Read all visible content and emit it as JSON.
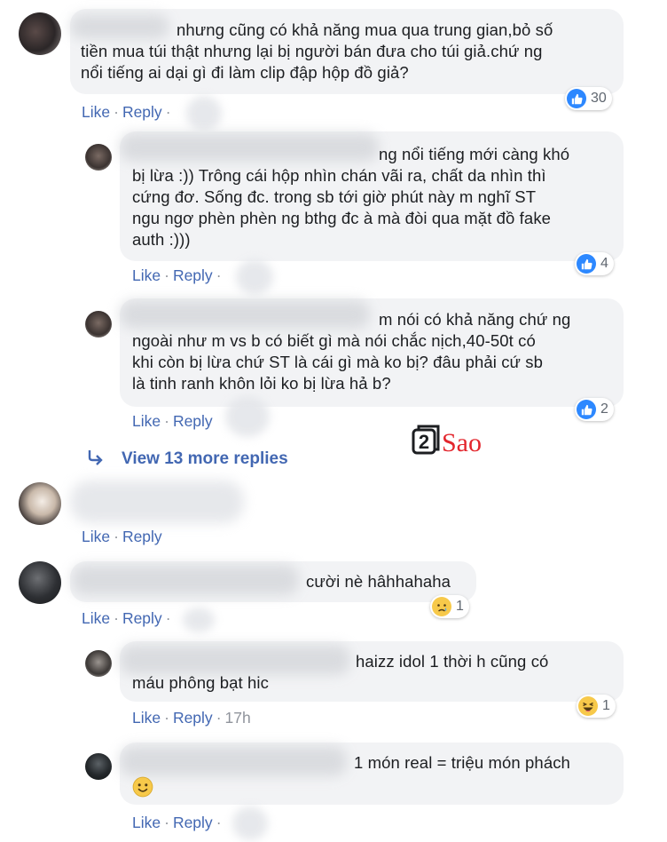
{
  "actions": {
    "like": "Like",
    "reply": "Reply",
    "separator": "·"
  },
  "comments": [
    {
      "text": "nhưng cũng có khả năng mua qua trung gian,bỏ số\ntiền mua túi thật nhưng lại bị người bán đưa cho túi giả.chứ ng\nnổi tiếng ai dại gì đi làm clip đập hộp đồ giả?",
      "reaction": {
        "type": "like",
        "count": "30"
      }
    },
    {
      "text": "ng nổi tiếng mới càng khó\nbị lừa :)) Trông cái hộp nhìn chán vãi ra, chất da nhìn thì\ncứng đơ. Sống đc. trong sb tới giờ phút này m nghĩ ST\nngu ngơ phèn phèn ng bthg đc à mà đòi qua mặt đồ fake\nauth :)))",
      "reaction": {
        "type": "like",
        "count": "4"
      }
    },
    {
      "text": "m nói có khả năng chứ ng\nngoài như m vs b có biết gì mà nói chắc nịch,40-50t có\nkhi còn bị lừa chứ ST là cái gì mà ko bị? đâu phải cứ sb\nlà tinh ranh khôn lỏi ko bị lừa hả b?",
      "reaction": {
        "type": "like",
        "count": "2"
      }
    },
    {
      "text": "cười nè hâhhahaha",
      "reaction": {
        "type": "sad",
        "count": "1"
      }
    },
    {
      "text": "haizz idol 1 thời h cũng có\nmáu phông bạt hic",
      "time": "17h",
      "reaction": {
        "type": "haha",
        "count": "1"
      }
    },
    {
      "text": "1 món real = triệu món phách",
      "emoji": "smile"
    }
  ],
  "view_more": {
    "label": "View 13 more replies",
    "icon": "reply-arrow-icon"
  },
  "watermark": {
    "digit": "2",
    "word": "Sao"
  },
  "colors": {
    "link": "#4267b2",
    "bubble": "#f2f3f5",
    "like_blue": "#2d88ff",
    "watermark_red": "#e3262d"
  }
}
